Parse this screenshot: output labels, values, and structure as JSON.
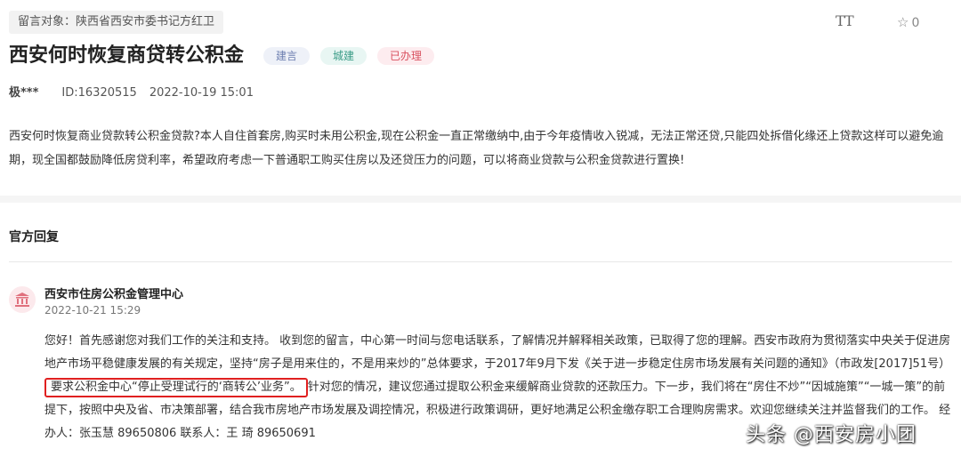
{
  "header": {
    "recipient": "留言对象：陕西省西安市委书记方红卫",
    "font_size_label": "TT",
    "favorite_count": "0"
  },
  "message": {
    "title": "西安何时恢复商贷转公积金",
    "tags": [
      "建言",
      "城建",
      "已办理"
    ],
    "author": "极***",
    "id": "ID:16320515",
    "date": "2022-10-19 15:01",
    "body": "西安何时恢复商业贷款转公积金贷款?本人自住首套房,购买时未用公积金,现在公积金一直正常缴纳中,由于今年疫情收入锐减，无法正常还贷,只能四处拆借化缘还上贷款这样可以避免逾期，现全国都鼓励降低房贷利率，希望政府考虑一下普通职工购买住房以及还贷压力的问题，可以将商业贷款与公积金贷款进行置换!"
  },
  "reply": {
    "section_title": "官方回复",
    "org": "西安市住房公积金管理中心",
    "date": "2022-10-21 15:29",
    "text_before": "您好！首先感谢您对我们工作的关注和支持。 收到您的留言，中心第一时间与您电话联系，了解情况并解释相关政策，已取得了您的理解。西安市政府为贯彻落实中央关于促进房地产市场平稳健康发展的有关规定，坚持“房子是用来住的，不是用来炒的”总体要求，于2017年9月下发《关于进一步稳定住房市场发展有关问题的通知》（市政发[2017]51号）",
    "text_highlight": "要求公积金中心“停止受理试行的‘商转公’业务”。",
    "text_after": "针对您的情况，建议您通过提取公积金来缓解商业贷款的还款压力。下一步，我们将在“房住不炒”“因城施策”“一城一策”的前提下，按照中央及省、市决策部署，结合我市房地产市场发展及调控情况，积极进行政策调研，更好地满足公积金缴存职工合理购房需求。欢迎您继续关注并监督我们的工作。 经办人：张玉慧 89650806 联系人：王 琦 89650691"
  },
  "watermark": "头条 @西安房小团",
  "icons": {
    "font_size": "text-size-icon",
    "favorite": "star-icon",
    "org": "government-building-icon"
  },
  "colors": {
    "highlight_border": "#e02020",
    "tag_done": "#d9505f",
    "tag_city": "#3a9c87",
    "tag_advice": "#6d7fb0"
  }
}
